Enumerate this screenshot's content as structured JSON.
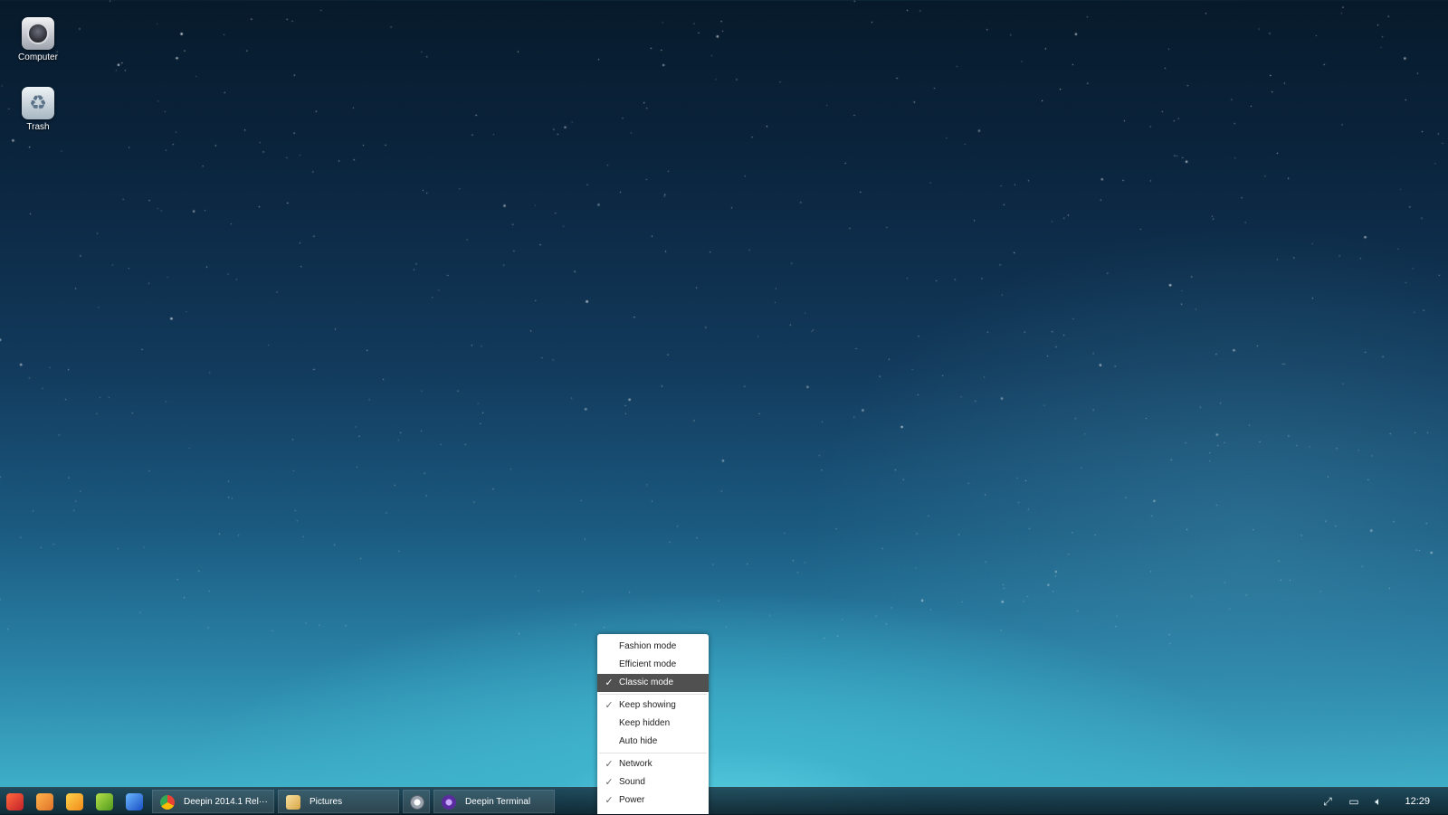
{
  "desktop": {
    "icons": [
      {
        "label": "Computer",
        "icon": "computer-icon"
      },
      {
        "label": "Trash",
        "icon": "trash-icon"
      }
    ]
  },
  "dock_menu": {
    "display_modes": [
      {
        "label": "Fashion mode",
        "checked": false
      },
      {
        "label": "Efficient mode",
        "checked": false
      },
      {
        "label": "Classic mode",
        "checked": true,
        "highlighted": true
      }
    ],
    "hide_modes": [
      {
        "label": "Keep showing",
        "checked": true
      },
      {
        "label": "Keep hidden",
        "checked": false
      },
      {
        "label": "Auto hide",
        "checked": false
      }
    ],
    "plugins": [
      {
        "label": "Network",
        "checked": true
      },
      {
        "label": "Sound",
        "checked": true
      },
      {
        "label": "Power",
        "checked": true
      }
    ]
  },
  "taskbar": {
    "launchers": [
      "launcher-icon",
      "file-manager-icon",
      "music-icon",
      "software-center-icon",
      "browser-icon"
    ],
    "tasks": [
      {
        "label": "Deepin 2014.1 Rel···",
        "icon": "chrome-icon"
      },
      {
        "label": "Pictures",
        "icon": "folder-icon"
      },
      {
        "label": "",
        "icon": "settings-icon"
      },
      {
        "label": "Deepin Terminal",
        "icon": "terminal-icon"
      }
    ],
    "tray": [
      "network-icon",
      "battery-icon",
      "volume-icon"
    ],
    "clock": "12:29"
  },
  "colors": {
    "menu_highlight": "#505050",
    "taskbar": "#14283a"
  }
}
